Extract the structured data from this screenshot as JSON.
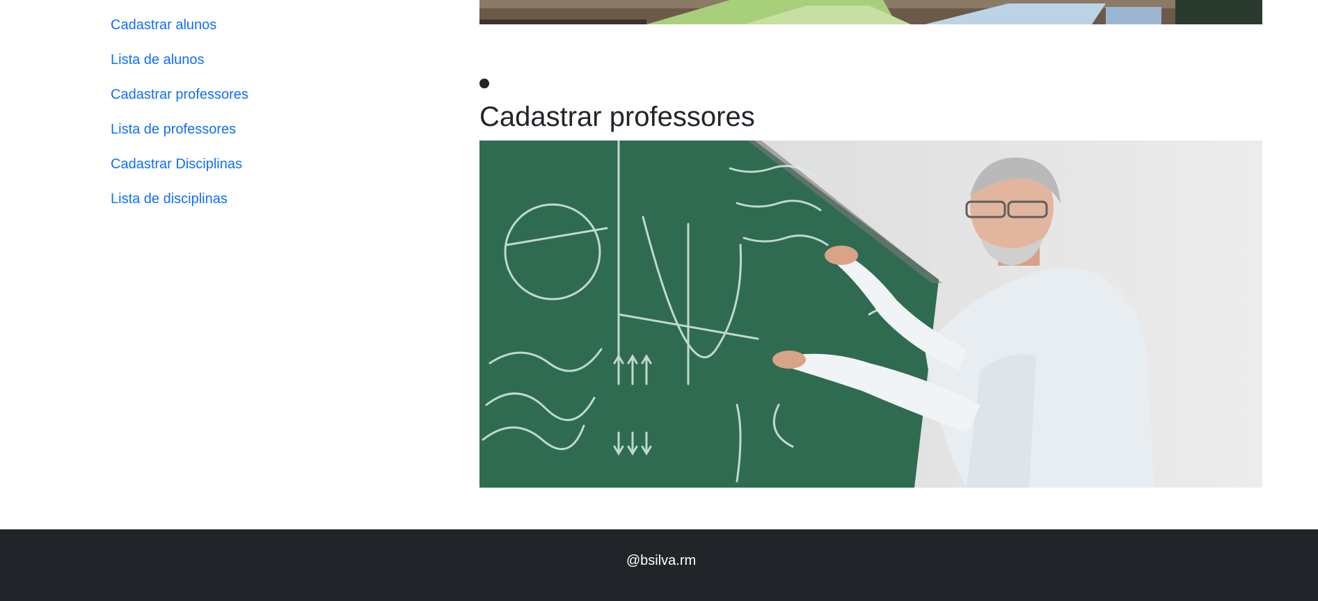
{
  "sidebar": {
    "items": [
      {
        "label": "Cadastrar alunos"
      },
      {
        "label": "Lista de alunos"
      },
      {
        "label": "Cadastrar professores"
      },
      {
        "label": "Lista de professores"
      },
      {
        "label": "Cadastrar Disciplinas"
      },
      {
        "label": "Lista de disciplinas"
      }
    ]
  },
  "main": {
    "section_title": "Cadastrar professores"
  },
  "footer": {
    "text": "@bsilva.rm"
  },
  "colors": {
    "link": "#0d6efd",
    "text": "#212529",
    "footer_bg": "#212529",
    "chalkboard": "#2e6a4f"
  }
}
